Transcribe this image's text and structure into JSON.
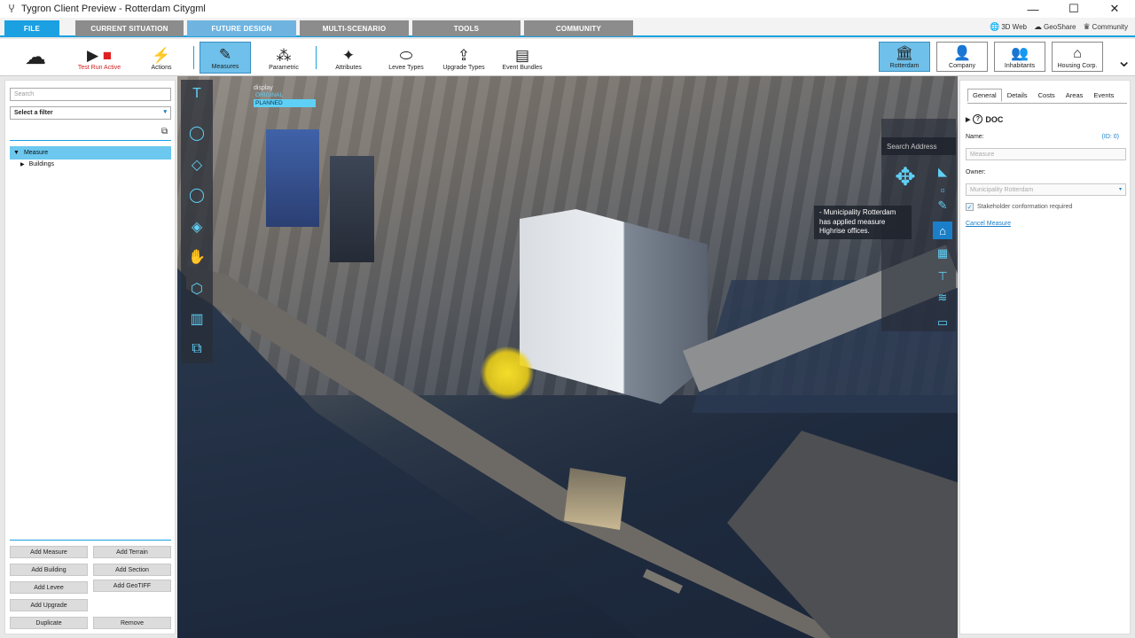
{
  "window": {
    "title": "Tygron Client Preview - Rotterdam Citygml",
    "controls": [
      "—",
      "☐",
      "✕"
    ]
  },
  "tabs": [
    {
      "label": "FILE"
    },
    {
      "label": "CURRENT SITUATION"
    },
    {
      "label": "FUTURE DESIGN"
    },
    {
      "label": "MULTI-SCENARIO"
    },
    {
      "label": "TOOLS"
    },
    {
      "label": "COMMUNITY"
    }
  ],
  "header_links": {
    "web3d": "3D Web",
    "geoshare": "GeoShare",
    "community": "Community"
  },
  "ribbon": {
    "test_run": "Test Run Active",
    "actions": "Actions",
    "measures": "Measures",
    "parametric": "Parametric",
    "attributes": "Attributes",
    "levee_types": "Levee Types",
    "upgrade_types": "Upgrade Types",
    "event_bundles": "Event Bundles"
  },
  "stakeholders": [
    {
      "label": "Rotterdam",
      "icon": "city-hall-icon"
    },
    {
      "label": "Company",
      "icon": "user-icon"
    },
    {
      "label": "Inhabitants",
      "icon": "people-icon"
    },
    {
      "label": "Housing Corp.",
      "icon": "house-icon"
    }
  ],
  "left_panel": {
    "search_placeholder": "Search",
    "filter": "Select a filter",
    "tree": {
      "root": "Measure",
      "child": "Buildings"
    },
    "buttons": {
      "add_measure": "Add Measure",
      "add_terrain": "Add Terrain",
      "add_building": "Add Building",
      "add_section": "Add Section",
      "add_levee": "Add Levee",
      "add_geotiff": "Add GeoTIFF",
      "add_upgrade": "Add Upgrade",
      "duplicate": "Duplicate",
      "remove": "Remove"
    }
  },
  "viewport": {
    "display_label": "display",
    "display_options": [
      "ORIGINAL",
      "PLANNED"
    ],
    "selected_display": "PLANNED",
    "search_address": "Search Address",
    "notification": {
      "line1": "- Municipality Rotterdam",
      "line2": "has applied measure",
      "line3": "Highrise offices."
    }
  },
  "right_panel": {
    "tabs": [
      "General",
      "Details",
      "Costs",
      "Areas",
      "Events"
    ],
    "active_tab": "General",
    "doc_label": "DOC",
    "name_label": "Name:",
    "id_link": "(ID: 0)",
    "name_value": "Measure",
    "owner_label": "Owner:",
    "owner_value": "Municipality Rotterdam",
    "checkbox_label": "Stakeholder conformation required",
    "checkbox_checked": true,
    "cancel_link": "Cancel Measure"
  },
  "colors": {
    "accent": "#1ba0e2",
    "selected": "#6fc0ea",
    "link": "#1a7fc8",
    "highlight": "#f0d214"
  }
}
